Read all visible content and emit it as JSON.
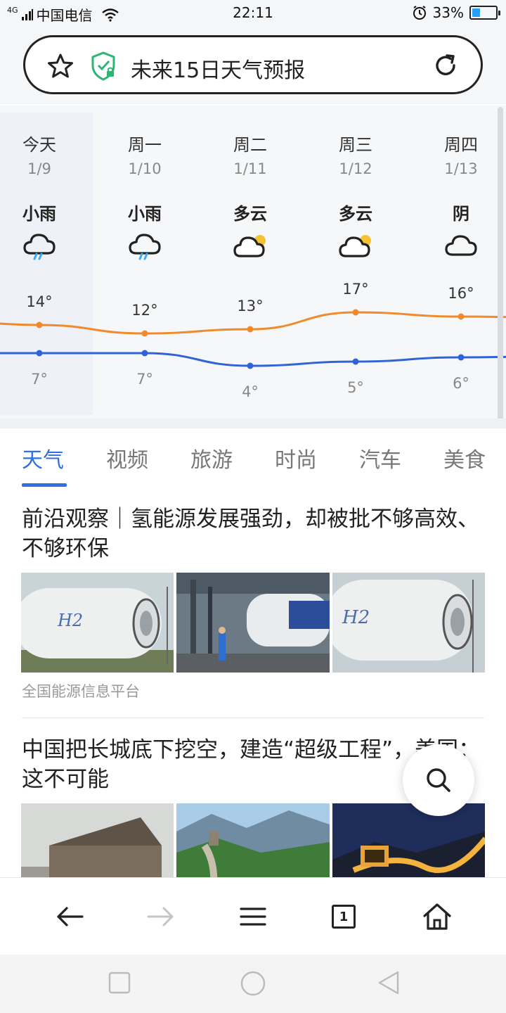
{
  "status_bar": {
    "network": "4G",
    "carrier": "中国电信",
    "time": "22:11",
    "battery": "33%",
    "battery_level": 0.33
  },
  "address_bar": {
    "title": "未来15日天气预报"
  },
  "weather": {
    "days": [
      {
        "name": "今天",
        "date": "1/9",
        "condition": "小雨",
        "icon": "rain-cloud-icon",
        "high": "14°",
        "low": "7°"
      },
      {
        "name": "周一",
        "date": "1/10",
        "condition": "小雨",
        "icon": "rain-cloud-icon",
        "high": "12°",
        "low": "7°"
      },
      {
        "name": "周二",
        "date": "1/11",
        "condition": "多云",
        "icon": "partly-cloudy-icon",
        "high": "13°",
        "low": "4°"
      },
      {
        "name": "周三",
        "date": "1/12",
        "condition": "多云",
        "icon": "partly-cloudy-icon",
        "high": "17°",
        "low": "5°"
      },
      {
        "name": "周四",
        "date": "1/13",
        "condition": "阴",
        "icon": "overcast-cloud-icon",
        "high": "16°",
        "low": "6°"
      }
    ],
    "colors": {
      "high_line": "#f08a2c",
      "low_line": "#2f63d6"
    }
  },
  "tabs": [
    "天气",
    "视频",
    "旅游",
    "时尚",
    "汽车",
    "美食"
  ],
  "active_tab": "天气",
  "articles": [
    {
      "title": "前沿观察｜氢能源发展强劲，却被批不够高效、不够环保",
      "source": "全国能源信息平台"
    },
    {
      "title": "中国把长城底下挖空，建造“超级工程”，美国：这不可能",
      "source": ""
    }
  ],
  "toolbar": {
    "tab_count": "1"
  },
  "colors": {
    "accent": "#2f6fe0",
    "shield": "#2bb673"
  }
}
